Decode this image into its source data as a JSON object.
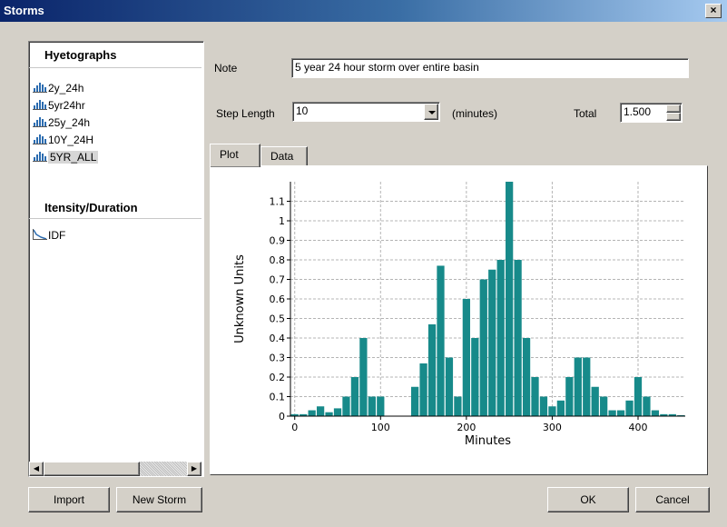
{
  "window": {
    "title": "Storms",
    "close_label": "×"
  },
  "left_panel": {
    "hyetographs_title": "Hyetographs",
    "hyetographs": [
      {
        "label": "2y_24h",
        "icon": "hyetograph-icon"
      },
      {
        "label": "5yr24hr",
        "icon": "hyetograph-icon"
      },
      {
        "label": "25y_24h",
        "icon": "hyetograph-icon"
      },
      {
        "label": "10Y_24H",
        "icon": "hyetograph-icon"
      },
      {
        "label": "5YR_ALL",
        "icon": "hyetograph-icon",
        "selected": true
      }
    ],
    "intensity_title": "Itensity/Duration",
    "intensity_items": [
      {
        "label": "IDF",
        "icon": "idf-curve-icon"
      }
    ]
  },
  "form": {
    "note_label": "Note",
    "note_value": "5 year 24 hour storm over entire basin",
    "step_label": "Step Length",
    "step_value": "10",
    "step_unit": "(minutes)",
    "total_label": "Total",
    "total_value": "1.500"
  },
  "tabs": [
    {
      "label": "Plot",
      "active": true
    },
    {
      "label": "Data",
      "active": false
    }
  ],
  "buttons": {
    "import": "Import",
    "new_storm": "New Storm",
    "ok": "OK",
    "cancel": "Cancel"
  },
  "colors": {
    "bar": "#178a8a",
    "title_gradient_start": "#0a246a",
    "dialog_bg": "#d4d0c8"
  },
  "chart_data": {
    "type": "bar",
    "xlabel": "Minutes",
    "ylabel": "Unknown Units",
    "xlim": [
      -5,
      455
    ],
    "ylim": [
      0,
      1.2
    ],
    "x_ticks": [
      0,
      100,
      200,
      300,
      400
    ],
    "y_ticks": [
      0,
      0.1,
      0.2,
      0.3,
      0.4,
      0.5,
      0.6,
      0.7,
      0.8,
      0.9,
      1,
      1.1
    ],
    "y_tick_labels": [
      "0",
      "0.1",
      "0.2",
      "0.3",
      "0.4",
      "0.5",
      "0.6",
      "0.7",
      "0.8",
      "0.9",
      "1",
      "1.1"
    ],
    "x_tick_labels": [
      "0",
      "100",
      "200",
      "300",
      "400"
    ],
    "grid": true,
    "bar_width": 10,
    "x": [
      0,
      10,
      20,
      30,
      40,
      50,
      60,
      70,
      80,
      90,
      100,
      110,
      120,
      130,
      140,
      150,
      160,
      170,
      180,
      190,
      200,
      210,
      220,
      230,
      240,
      250,
      260,
      270,
      280,
      290,
      300,
      310,
      320,
      330,
      340,
      350,
      360,
      370,
      380,
      390,
      400,
      410,
      420,
      430,
      440,
      450
    ],
    "values": [
      0.01,
      0.01,
      0.03,
      0.05,
      0.02,
      0.04,
      0.1,
      0.2,
      0.4,
      0.1,
      0.1,
      0,
      0,
      0,
      0.15,
      0.27,
      0.47,
      0.77,
      0.3,
      0.1,
      0.6,
      0.4,
      0.7,
      0.75,
      0.8,
      1.2,
      0.8,
      0.4,
      0.2,
      0.1,
      0.05,
      0.08,
      0.2,
      0.3,
      0.3,
      0.15,
      0.1,
      0.03,
      0.03,
      0.08,
      0.2,
      0.1,
      0.03,
      0.01,
      0.01,
      0.005
    ]
  }
}
